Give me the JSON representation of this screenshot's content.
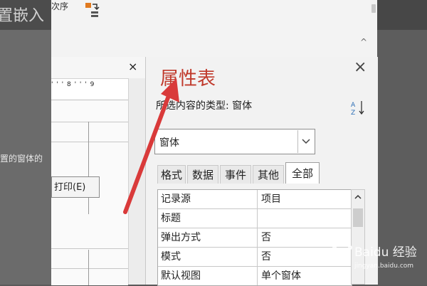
{
  "background": {
    "left_title": "置嵌入",
    "left_text": "置的窗体的"
  },
  "ribbon": {
    "order_label": "次序",
    "collapse": "^"
  },
  "form": {
    "close": "×",
    "ruler": "' ' ' 8 ' ' ' 9",
    "print_button": "打印(E)"
  },
  "property_sheet": {
    "title": "属性表",
    "close": "×",
    "subtitle": "所选内容的类型: 窗体",
    "selector_value": "窗体",
    "tabs": [
      "格式",
      "数据",
      "事件",
      "其他",
      "全部"
    ],
    "active_tab": "全部",
    "rows": [
      {
        "name": "记录源",
        "value": "项目"
      },
      {
        "name": "标题",
        "value": ""
      },
      {
        "name": "弹出方式",
        "value": "否"
      },
      {
        "name": "模式",
        "value": "否"
      },
      {
        "name": "默认视图",
        "value": "单个窗体"
      }
    ]
  },
  "watermark": {
    "text": "Baidu 经验",
    "url": "jingyan.baidu.com"
  },
  "colors": {
    "title_red": "#c0392b",
    "arrow_red": "#d93a3a"
  }
}
